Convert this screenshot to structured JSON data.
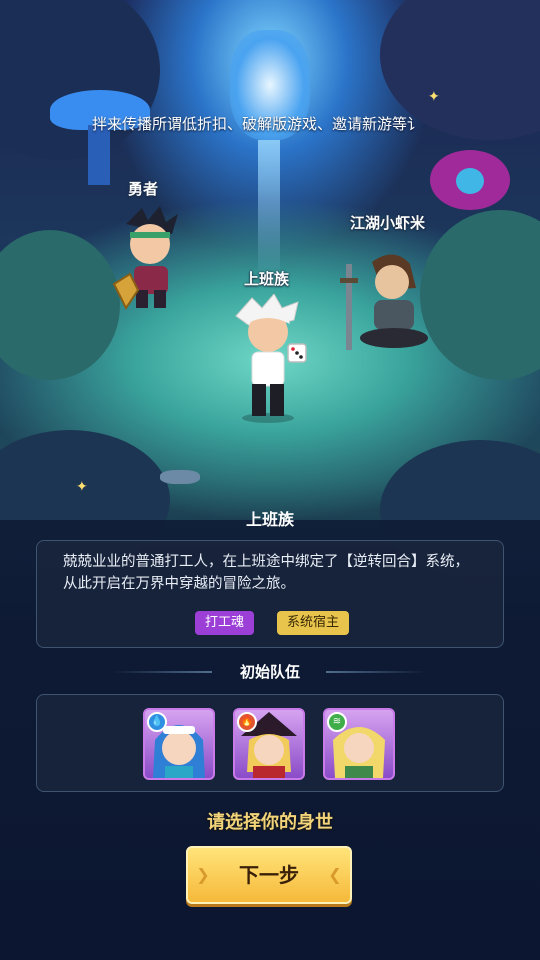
{
  "ticker": {
    "text": "拌来传播所谓低折扣、破解版游戏、邀请新游等讠"
  },
  "characters": [
    {
      "name": "勇者"
    },
    {
      "name": "江湖小虾米"
    },
    {
      "name": "上班族"
    }
  ],
  "identity": {
    "title": "上班族",
    "description": "兢兢业业的普通打工人，在上班途中绑定了【逆转回合】系统，从此开启在万界中穿越的冒险之旅。",
    "tags": [
      "打工魂",
      "系统宿主"
    ]
  },
  "team": {
    "title": "初始队伍",
    "members": [
      {
        "element_icon": "water-drop-icon",
        "element_color": "#2f8fe0"
      },
      {
        "element_icon": "fire-icon",
        "element_color": "#e2552e"
      },
      {
        "element_icon": "wind-icon",
        "element_color": "#3fae4a"
      }
    ]
  },
  "prompt": "请选择你的身世",
  "next_button": "下一步"
}
